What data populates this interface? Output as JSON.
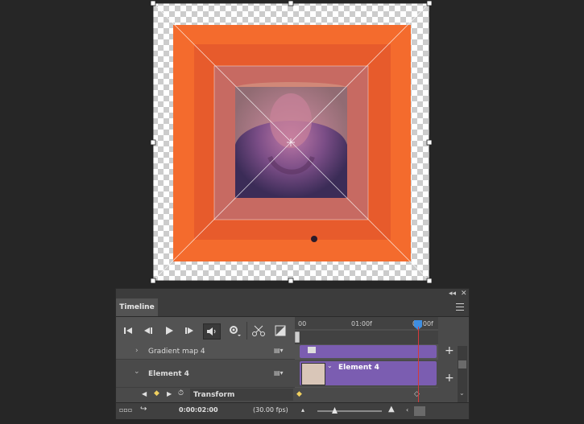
{
  "panel": {
    "top_controls": {
      "collapse": "◂◂",
      "close": "✕"
    },
    "tab_label": "Timeline",
    "menu_icon": "menu-icon"
  },
  "playback": {
    "first_frame_icon": "first-frame-icon",
    "prev_frame_icon": "previous-frame-icon",
    "play_icon": "play-icon",
    "next_frame_icon": "next-frame-icon",
    "audio_icon": "audio-icon",
    "settings_icon": "gear-icon",
    "split_icon": "scissors-icon",
    "transition_icon": "transition-icon"
  },
  "ruler": {
    "start": "00",
    "mid": "01:00f",
    "playhead": "02:00f"
  },
  "layers": [
    {
      "name": "Gradient map 4"
    },
    {
      "name": "Element 4",
      "clip_label": "Element 4"
    }
  ],
  "transform_row": {
    "label": "Transform"
  },
  "status": {
    "timecode": "0:00:02:00",
    "fps": "(30.00 fps)"
  },
  "colors": {
    "accent_purple": "#7b5db1",
    "playhead": "#d43a3a",
    "orange": "#fb6a2a"
  }
}
